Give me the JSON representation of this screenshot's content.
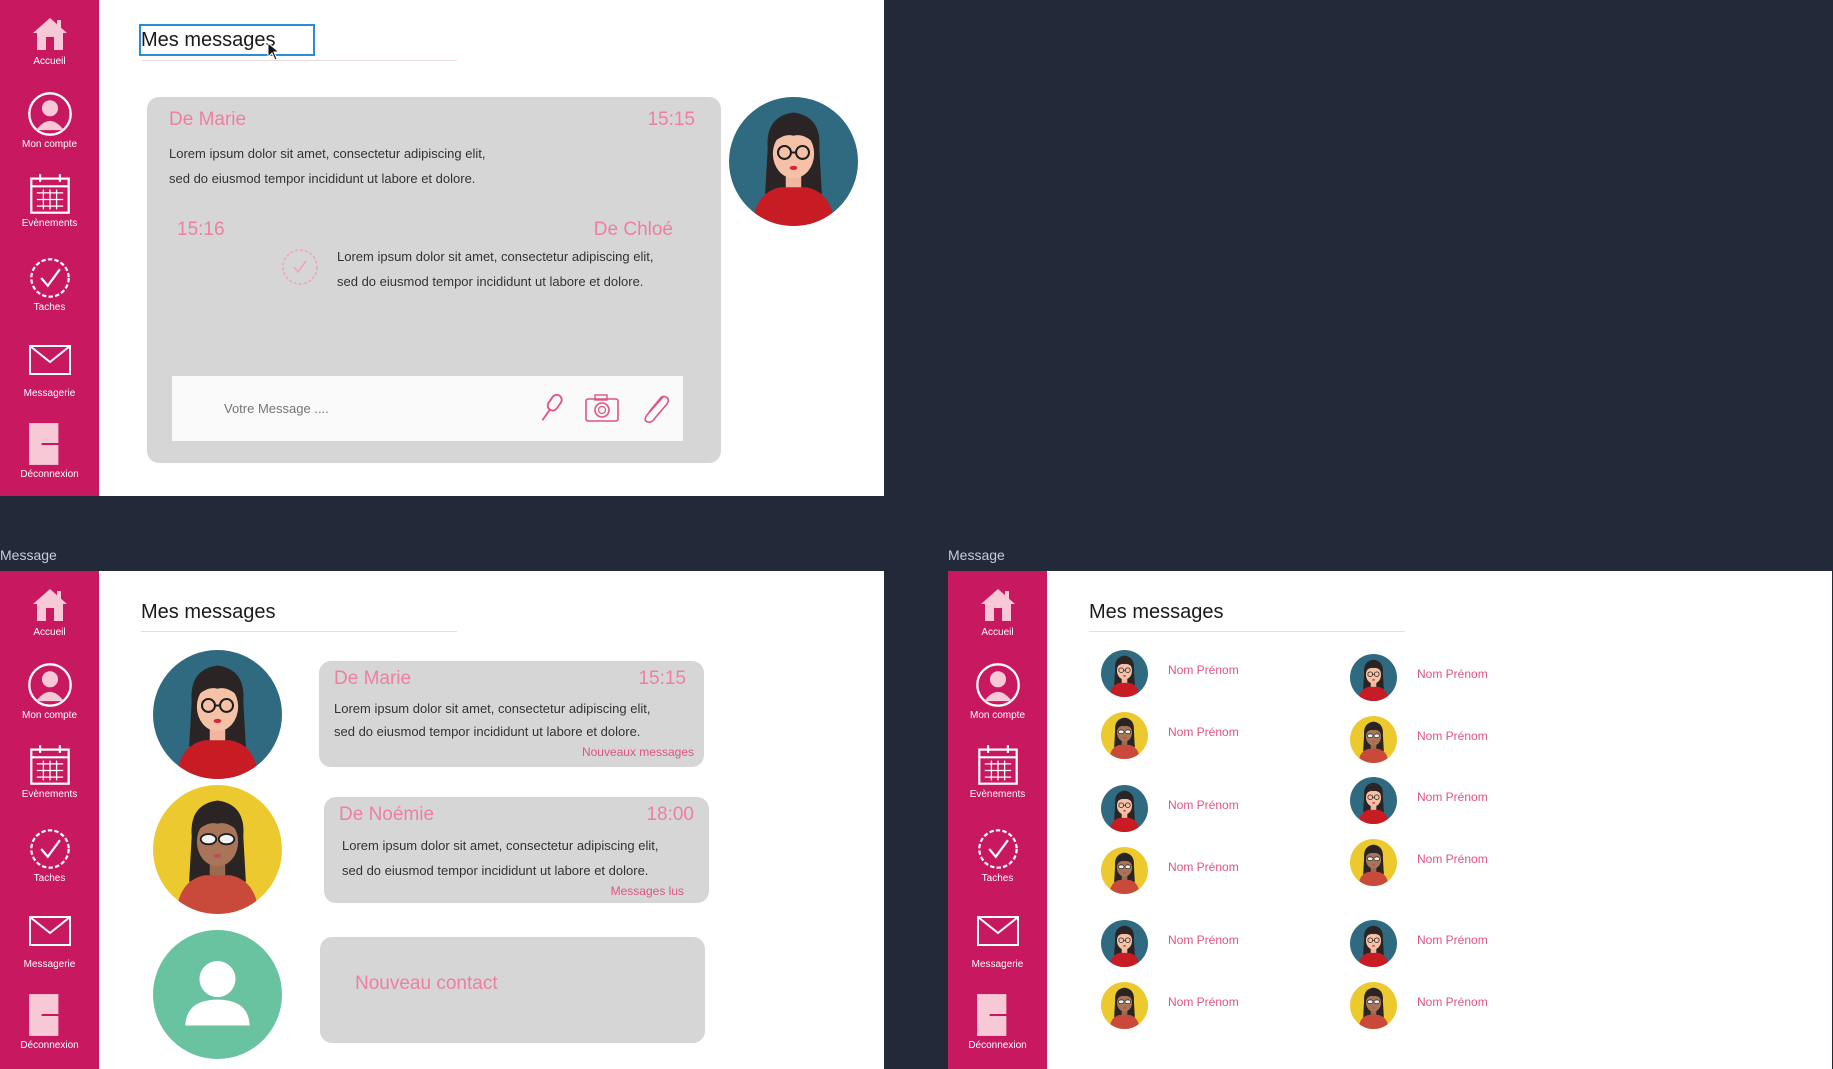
{
  "sidebar": {
    "items": [
      {
        "label": "Accueil",
        "icon": "home-icon"
      },
      {
        "label": "Mon compte",
        "icon": "user-icon"
      },
      {
        "label": "Evènements",
        "icon": "calendar-icon"
      },
      {
        "label": "Taches",
        "icon": "check-badge-icon"
      },
      {
        "label": "Messagerie",
        "icon": "mail-icon"
      },
      {
        "label": "Déconnexion",
        "icon": "logout-icon"
      }
    ]
  },
  "frames": {
    "conversation": {
      "title": "Mes messages",
      "message1": {
        "from": "De Marie",
        "time": "15:15",
        "line1": "Lorem ipsum dolor sit amet, consectetur adipiscing elit,",
        "line2": "sed do eiusmod tempor incididunt ut labore et dolore."
      },
      "message2": {
        "from": "De Chloé",
        "time": "15:16",
        "line1": "Lorem ipsum dolor sit amet, consectetur adipiscing elit,",
        "line2": "sed do eiusmod tempor incididunt ut labore et dolore."
      },
      "composer": {
        "placeholder": "Votre Message ...."
      }
    },
    "inbox": {
      "label": "Message",
      "title": "Mes messages",
      "threads": [
        {
          "from": "De Marie",
          "time": "15:15",
          "line1": "Lorem ipsum dolor sit amet, consectetur adipiscing elit,",
          "line2": "sed do eiusmod tempor incididunt ut labore et dolore.",
          "status": "Nouveaux messages"
        },
        {
          "from": "De Noémie",
          "time": "18:00",
          "line1": "Lorem ipsum dolor sit amet, consectetur adipiscing elit,",
          "line2": "sed do eiusmod tempor incididunt ut labore et dolore.",
          "status": "Messages lus"
        }
      ],
      "new_contact": "Nouveau contact"
    },
    "contacts": {
      "label": "Message",
      "title": "Mes messages",
      "left": [
        "Nom Prénom",
        "Nom Prénom",
        "Nom Prénom",
        "Nom Prénom",
        "Nom Prénom",
        "Nom Prénom"
      ],
      "right": [
        "Nom Prénom",
        "Nom Prénom",
        "Nom Prénom",
        "Nom Prénom",
        "Nom Prénom",
        "Nom Prénom"
      ]
    }
  },
  "colors": {
    "sidebar": "#c8185f",
    "accent": "#ee7fa0",
    "bubble": "#d6d6d6",
    "background": "#222a3a",
    "teal": "#2f6a80",
    "yellow": "#ecc92e",
    "green": "#69c3a0"
  }
}
